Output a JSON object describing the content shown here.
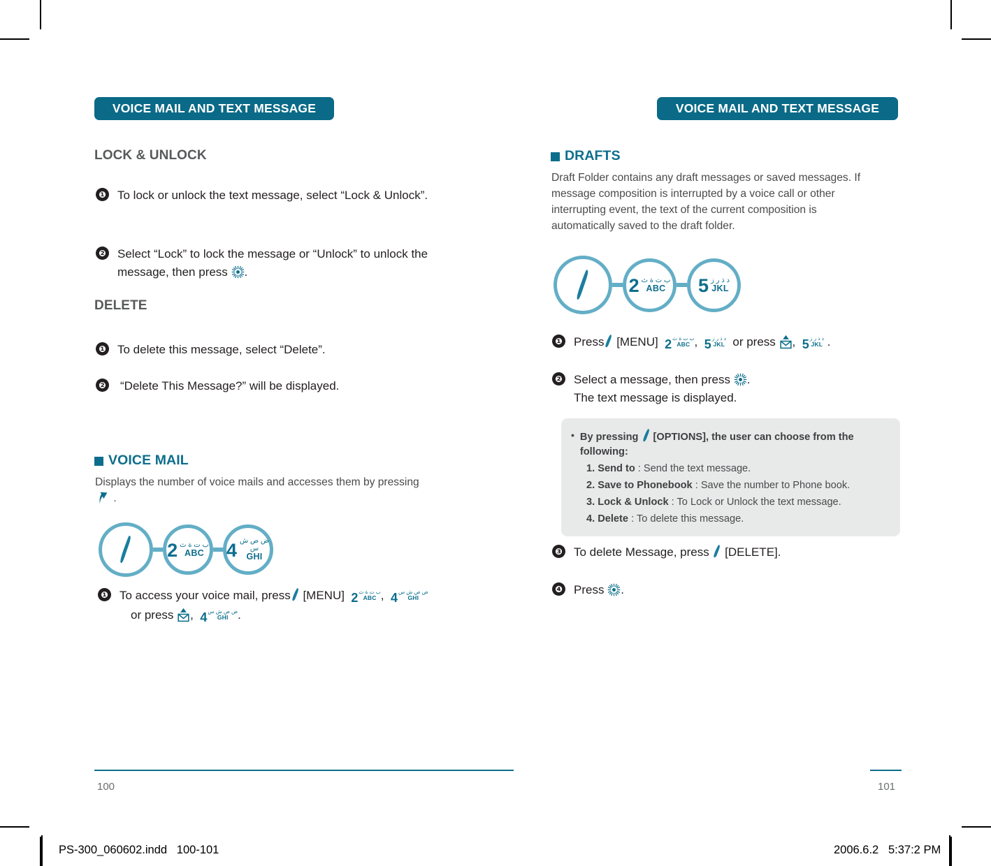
{
  "colors": {
    "banner_bg": "#0a6a87",
    "teal": "#0d6e8c",
    "light_blue": "#63aec6",
    "note_bg": "#e8e9e9",
    "heading_gray": "#58595b"
  },
  "left_page": {
    "banner": "VOICE MAIL AND TEXT MESSAGE",
    "folio": "100",
    "section_lock": {
      "heading": "LOCK & UNLOCK",
      "steps": [
        {
          "num": "❶",
          "text": "To lock or unlock the text message, select “Lock & Unlock”."
        },
        {
          "num": "❷",
          "text_before": "Select “Lock” to lock the message or “Unlock” to unlock the message, then press ",
          "text_after": "."
        }
      ]
    },
    "section_delete": {
      "heading": "DELETE",
      "steps": [
        {
          "num": "❶",
          "text": "To delete this message, select “Delete”."
        },
        {
          "num": "❷",
          "text": "“Delete This Message?” will be displayed."
        }
      ]
    },
    "section_voicemail": {
      "heading": "VOICE MAIL",
      "body_before": "Displays the number of voice mails and accesses them by pressing ",
      "body_after": " .",
      "chain": [
        {
          "type": "slash",
          "icon": "menu-slash-icon"
        },
        {
          "digit": "2",
          "arabic": "ب ت ة ث",
          "latin": "ABC"
        },
        {
          "digit": "4",
          "arabic": "ض ص ش س",
          "latin": "GHI"
        }
      ],
      "step": {
        "num": "❶",
        "part1": "To access your voice mail, press",
        "menu_label": "[MENU]",
        "key_a": {
          "digit": "2",
          "arabic": "ب ت ة ث",
          "latin": "ABC"
        },
        "comma": ",",
        "key_b": {
          "digit": "4",
          "arabic": "ض ص ش س",
          "latin": "GHI"
        },
        "part2": "or press",
        "key_c": {
          "digit": "4",
          "arabic": "ض ص ش س",
          "latin": "GHI"
        },
        "period": "."
      }
    }
  },
  "right_page": {
    "banner": "VOICE MAIL AND TEXT MESSAGE",
    "folio": "101",
    "section_drafts": {
      "heading": "DRAFTS",
      "body": "Draft Folder contains any draft messages or saved messages. If message composition is interrupted by a voice call or other interrupting event, the text of the current composition is automatically saved to the draft folder.",
      "chain": [
        {
          "type": "slash",
          "icon": "menu-slash-icon"
        },
        {
          "digit": "2",
          "arabic": "ب ت ة ث",
          "latin": "ABC"
        },
        {
          "digit": "5",
          "arabic": "د ذ ر ز",
          "latin": "JKL"
        }
      ],
      "steps": [
        {
          "num": "❶",
          "part1": "Press",
          "menu_label": "[MENU]",
          "key_a": {
            "digit": "2",
            "arabic": "ب ت ة ث",
            "latin": "ABC"
          },
          "comma": ",",
          "key_b": {
            "digit": "5",
            "arabic": "د ذ ر ز",
            "latin": "JKL"
          },
          "part2": "or press",
          "key_c": {
            "digit": "5",
            "arabic": "د ذ ر ز",
            "latin": "JKL"
          },
          "period": "."
        },
        {
          "num": "❷",
          "line1_before": "Select a message, then press ",
          "line1_after": ".",
          "line2": "The text message is displayed."
        },
        {
          "num": "❸",
          "before": "To delete Message, press ",
          "after": " [DELETE]."
        },
        {
          "num": "❹",
          "before": "Press ",
          "after": "."
        }
      ]
    },
    "note": {
      "bullet": "•",
      "lead_before": "By pressing ",
      "lead_after": " [OPTIONS], the user can choose from the following:",
      "items": [
        {
          "label": "1. Send to",
          "sep": " : ",
          "desc": "Send the text message."
        },
        {
          "label": "2. Save to Phonebook",
          "sep": " : ",
          "desc": "Save the number to Phone book."
        },
        {
          "label": "3. Lock & Unlock",
          "sep": " : ",
          "desc": "To Lock or Unlock the text message."
        },
        {
          "label": "4. Delete",
          "sep": " : ",
          "desc": "To delete this message."
        }
      ]
    }
  },
  "print_slug": {
    "filename": "PS-300_060602.indd   100-101",
    "timestamp": "2006.6.2   5:37:2 PM"
  }
}
